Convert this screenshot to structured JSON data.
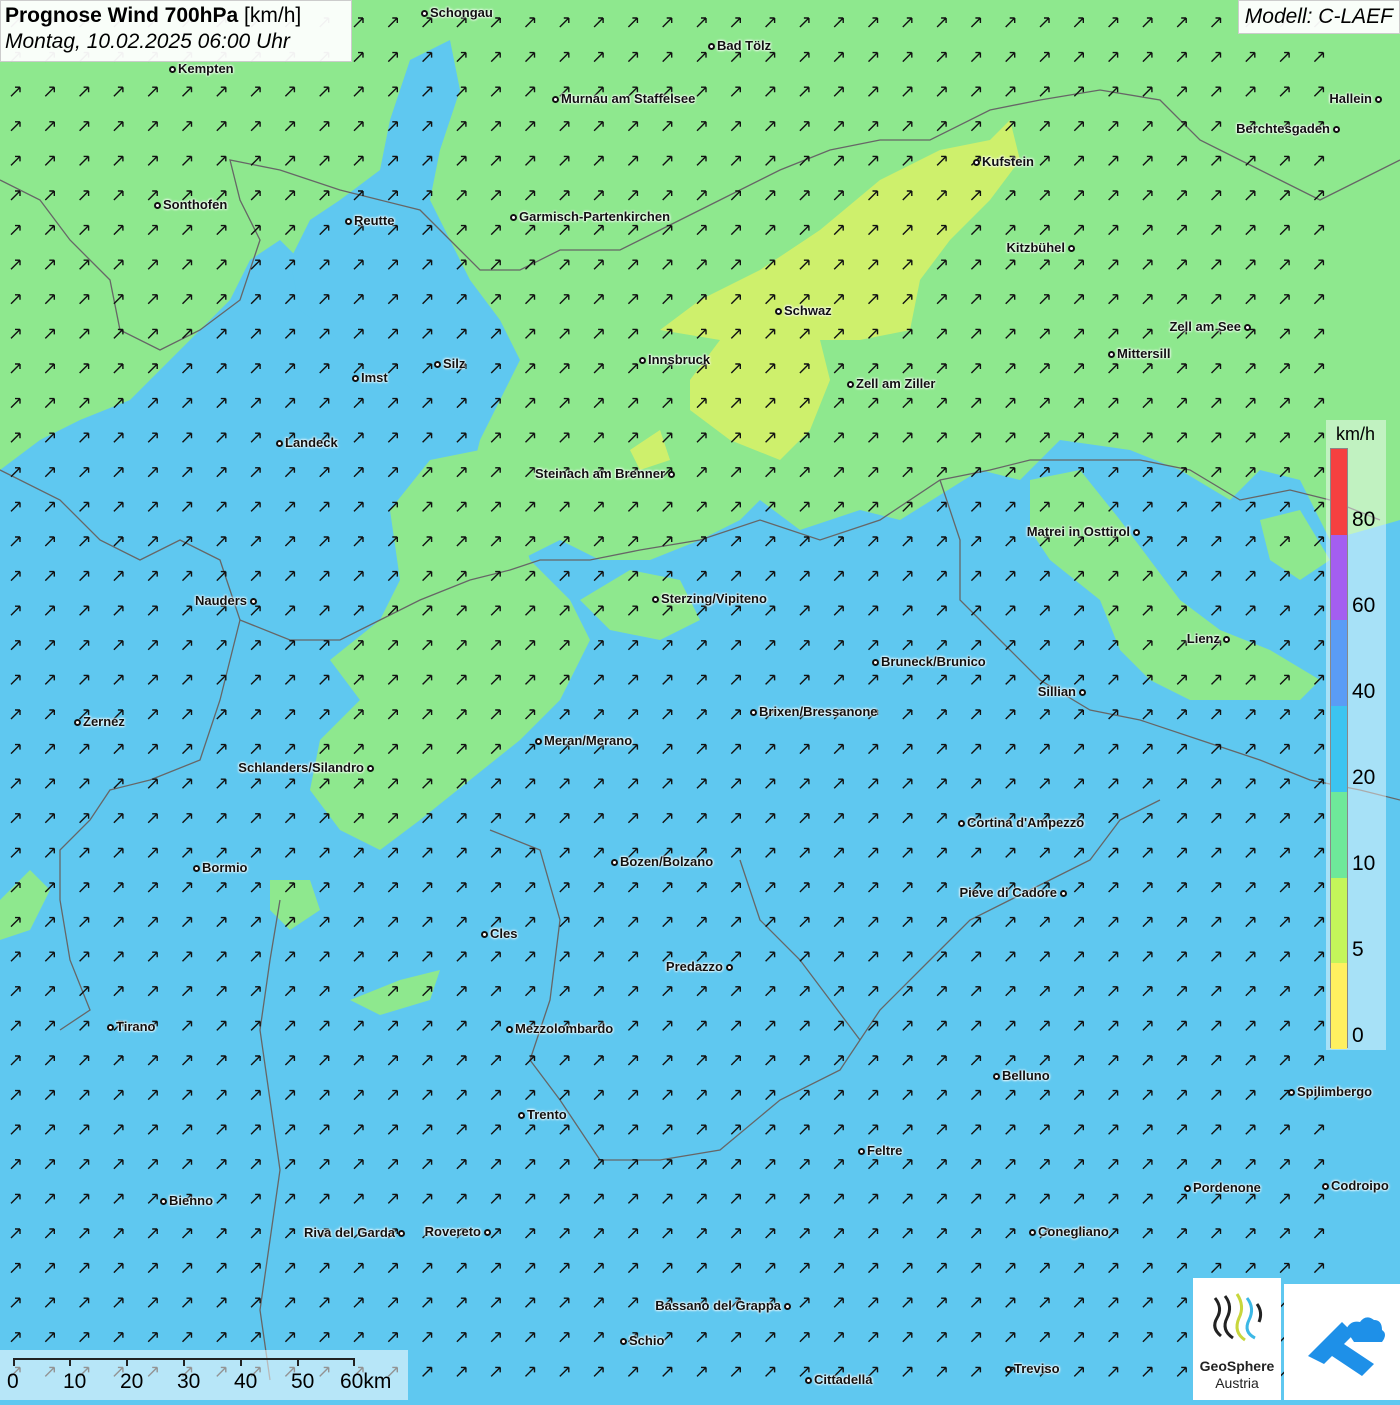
{
  "title": {
    "main_bold": "Prognose Wind 700hPa",
    "main_unit": "[km/h]",
    "subtitle": "Montag, 10.02.2025 06:00 Uhr"
  },
  "model_label": "Modell: C-LAEF",
  "legend": {
    "unit": "km/h",
    "colors": [
      "#f54040",
      "#a45ef0",
      "#5a9cf5",
      "#3cc4f0",
      "#6ee89a",
      "#c4f55a",
      "#fff060"
    ],
    "labels": [
      "80",
      "60",
      "40",
      "20",
      "10",
      "5",
      "0"
    ]
  },
  "scalebar": {
    "labels": [
      "0",
      "10",
      "20",
      "30",
      "40",
      "50",
      "60km"
    ]
  },
  "logos": {
    "geosphere_name": "GeoSphere",
    "geosphere_country": "Austria",
    "geosphere_icon": "geosphere-logo-icon",
    "cloud_icon": "cloud-arrow-logo-icon"
  },
  "map": {
    "wind_direction": "from southwest (arrows pointing northeast)",
    "colors": {
      "ocean_blue": "#5fc8f0",
      "green_zone": "#8ee88e",
      "yellow_green_zone": "#cef06c"
    },
    "cities": [
      {
        "name": "Schongau"
      },
      {
        "name": "Bad Tölz"
      },
      {
        "name": "Kempten"
      },
      {
        "name": "Murnau am Staffelsee"
      },
      {
        "name": "Hallein"
      },
      {
        "name": "Berchtesgaden"
      },
      {
        "name": "Kufstein"
      },
      {
        "name": "Sonthofen"
      },
      {
        "name": "Reutte"
      },
      {
        "name": "Garmisch-Partenkirchen"
      },
      {
        "name": "Kitzbühel"
      },
      {
        "name": "Schwaz"
      },
      {
        "name": "Zell am See"
      },
      {
        "name": "Innsbruck"
      },
      {
        "name": "Mittersill"
      },
      {
        "name": "Silz"
      },
      {
        "name": "Imst"
      },
      {
        "name": "Zell am Ziller"
      },
      {
        "name": "Landeck"
      },
      {
        "name": "Steinach am Brenner"
      },
      {
        "name": "Matrei in Osttirol"
      },
      {
        "name": "Nauders"
      },
      {
        "name": "Sterzing/Vipiteno"
      },
      {
        "name": "Lienz"
      },
      {
        "name": "Bruneck/Brunico"
      },
      {
        "name": "Sillian"
      },
      {
        "name": "Brixen/Bressanone"
      },
      {
        "name": "Zernez"
      },
      {
        "name": "Meran/Merano"
      },
      {
        "name": "Schlanders/Silandro"
      },
      {
        "name": "Cortina d'Ampezzo"
      },
      {
        "name": "Bozen/Bolzano"
      },
      {
        "name": "Bormio"
      },
      {
        "name": "Pieve di Cadore"
      },
      {
        "name": "Cles"
      },
      {
        "name": "Predazzo"
      },
      {
        "name": "Tirano"
      },
      {
        "name": "Mezzolombardo"
      },
      {
        "name": "Belluno"
      },
      {
        "name": "Spilimbergo"
      },
      {
        "name": "Trento"
      },
      {
        "name": "Feltre"
      },
      {
        "name": "Pordenone"
      },
      {
        "name": "Codroipo"
      },
      {
        "name": "Bienno"
      },
      {
        "name": "Riva del Garda"
      },
      {
        "name": "Rovereto"
      },
      {
        "name": "Conegliano"
      },
      {
        "name": "Bassano del Grappa"
      },
      {
        "name": "Schio"
      },
      {
        "name": "Treviso"
      },
      {
        "name": "Cittadella"
      }
    ]
  }
}
